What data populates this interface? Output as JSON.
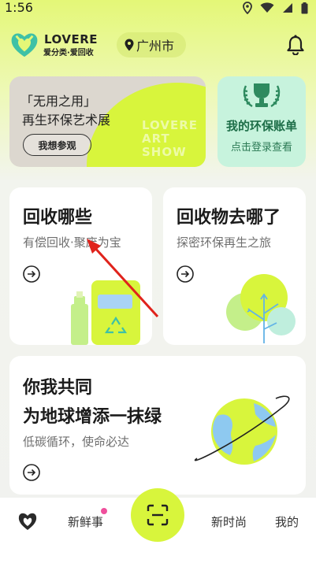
{
  "status_bar": {
    "time": "1:56"
  },
  "header": {
    "brand_en": "LOVERE",
    "brand_cn": "爱分类·爱回收",
    "city": "广州市"
  },
  "banner": {
    "line1": "「无用之用」",
    "line2": "再生环保艺术展",
    "button": "我想参观",
    "watermark": [
      "LOVERE",
      "ART",
      "SHOW"
    ]
  },
  "account_card": {
    "title": "我的环保账单",
    "subtitle": "点击登录查看"
  },
  "cards": [
    {
      "title": "回收哪些",
      "subtitle": "有偿回收·聚废为宝"
    },
    {
      "title": "回收物去哪了",
      "subtitle": "探密环保再生之旅"
    },
    {
      "title_line1": "你我共同",
      "title_line2": "为地球增添一抹绿",
      "subtitle": "低碳循环，使命必达"
    }
  ],
  "tabbar": {
    "tabs": [
      "新鲜事",
      "新时尚",
      "我的"
    ]
  },
  "colors": {
    "accent_lime": "#d8f53c",
    "mint": "#c7f3dd",
    "green_text": "#1d6e48",
    "notification_dot": "#ef4f9c",
    "pointer_red": "#e0231c"
  }
}
